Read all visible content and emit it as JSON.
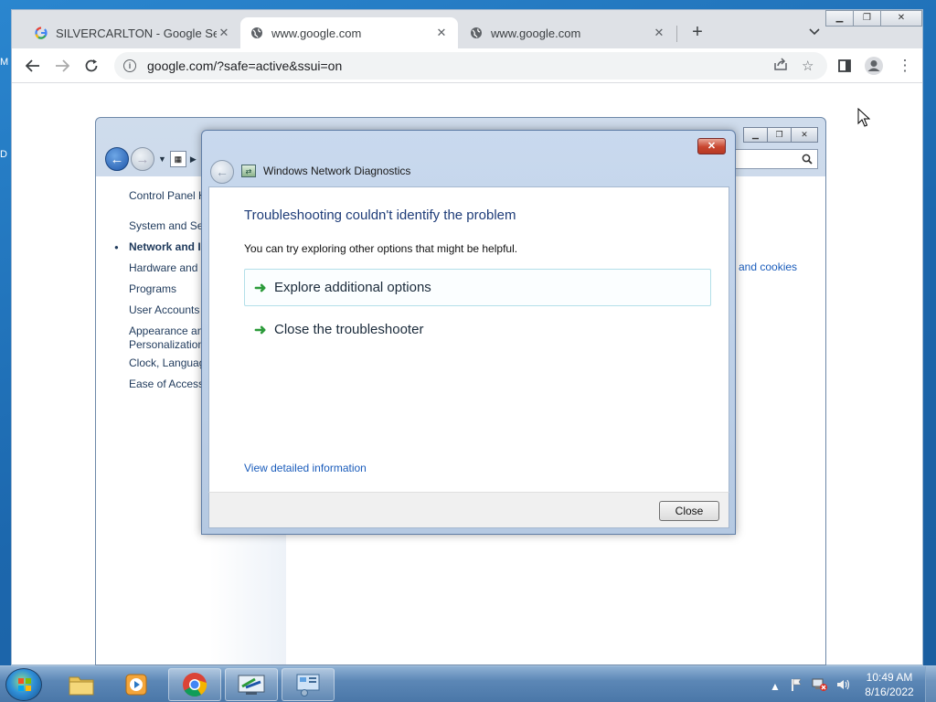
{
  "desktop": {
    "labels": [
      "M",
      "D"
    ]
  },
  "browser": {
    "tabs": [
      {
        "title": "SILVERCARLTON - Google Search",
        "favicon": "google-g-icon",
        "active": false
      },
      {
        "title": "www.google.com",
        "favicon": "globe-icon",
        "active": true
      },
      {
        "title": "www.google.com",
        "favicon": "globe-icon",
        "active": false
      }
    ],
    "url": "google.com/?safe=active&ssui=on"
  },
  "control_panel": {
    "items": [
      "Control Panel H",
      "System and Sec",
      "Network and I",
      "Hardware and S",
      "Programs",
      "User Accounts",
      "Appearance an",
      "Personalization",
      "Clock, Languag",
      "Ease of Access"
    ],
    "selected_index": 2,
    "right_link": "and cookies"
  },
  "dialog": {
    "title": "Windows Network Diagnostics",
    "heading": "Troubleshooting couldn't identify the problem",
    "description": "You can try exploring other options that might be helpful.",
    "options": [
      "Explore additional options",
      "Close the troubleshooter"
    ],
    "detail_link": "View detailed information",
    "close_button": "Close"
  },
  "taskbar": {
    "apps": [
      "file-explorer-icon",
      "media-player-icon",
      "chrome-icon",
      "network-diagnostics-icon",
      "control-panel-icon"
    ],
    "time": "10:49 AM",
    "date": "8/16/2022"
  },
  "colors": {
    "accent": "#1a5cbb",
    "heading": "#1e3c78",
    "option_arrow": "#2c9b3a"
  }
}
